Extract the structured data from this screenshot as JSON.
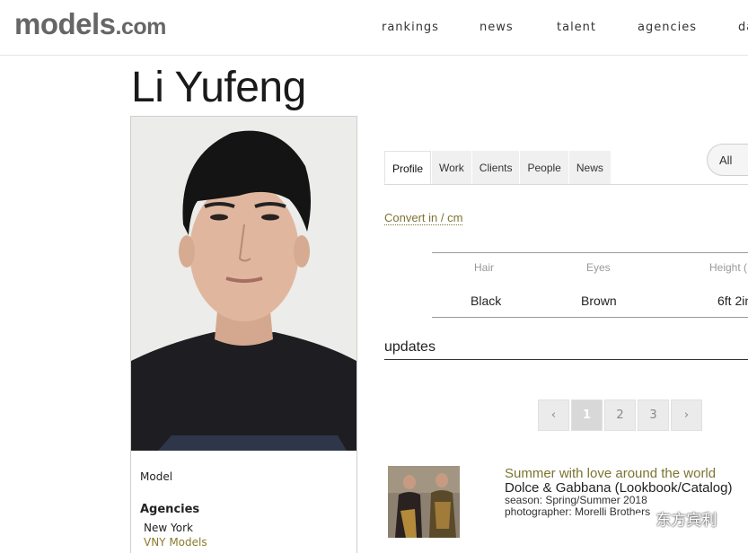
{
  "header": {
    "logo_main": "models",
    "logo_suffix": ".com",
    "nav": [
      "rankings",
      "news",
      "talent",
      "agencies",
      "da"
    ]
  },
  "profile": {
    "name": "Li Yufeng",
    "role": "Model",
    "agencies_heading": "Agencies",
    "agency_city": "New York",
    "agency_name": "VNY Models"
  },
  "tabs": [
    "Profile",
    "Work",
    "Clients",
    "People",
    "News"
  ],
  "filter": {
    "all_label": "All"
  },
  "convert_label": "Convert in / cm",
  "stats": {
    "headers": [
      "Hair",
      "Eyes",
      "Height ("
    ],
    "values": [
      "Black",
      "Brown",
      "6ft 2in"
    ]
  },
  "updates": {
    "heading": "updates",
    "pages": [
      "‹",
      "1",
      "2",
      "3",
      "›"
    ],
    "item": {
      "title": "Summer with love around the world",
      "subtitle": "Dolce & Gabbana (Lookbook/Catalog)",
      "season": "season: Spring/Summer 2018",
      "photographer": "photographer: Morelli Brothers"
    }
  },
  "watermark": "东方宾利",
  "colors": {
    "accent_olive": "#7d7330",
    "link_gold": "#8a7a2e"
  }
}
